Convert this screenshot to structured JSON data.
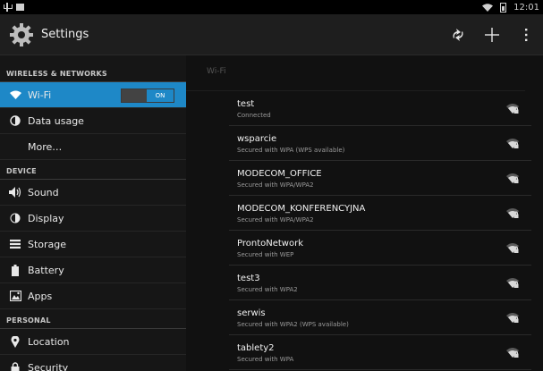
{
  "statusbar": {
    "time": "12:01"
  },
  "app": {
    "title": "Settings"
  },
  "sidebar": {
    "sections": [
      "WIRELESS & NETWORKS",
      "DEVICE",
      "PERSONAL"
    ],
    "wireless": [
      {
        "label": "Wi-Fi",
        "icon": "wifi-icon",
        "selected": true,
        "toggle": "ON"
      },
      {
        "label": "Data usage",
        "icon": "data-usage-icon"
      },
      {
        "label": "More…",
        "icon": ""
      }
    ],
    "device": [
      {
        "label": "Sound",
        "icon": "sound-icon"
      },
      {
        "label": "Display",
        "icon": "display-icon"
      },
      {
        "label": "Storage",
        "icon": "storage-icon"
      },
      {
        "label": "Battery",
        "icon": "battery-icon"
      },
      {
        "label": "Apps",
        "icon": "apps-icon"
      }
    ],
    "personal": [
      {
        "label": "Location",
        "icon": "location-icon"
      },
      {
        "label": "Security",
        "icon": "security-icon"
      }
    ]
  },
  "wifi": {
    "header": "Wi-Fi",
    "networks": [
      {
        "ssid": "test",
        "status": "Connected"
      },
      {
        "ssid": "wsparcie",
        "status": "Secured with WPA (WPS available)"
      },
      {
        "ssid": "MODECOM_OFFICE",
        "status": "Secured with WPA/WPA2"
      },
      {
        "ssid": "MODECOM_KONFERENCYJNA",
        "status": "Secured with WPA/WPA2"
      },
      {
        "ssid": "ProntoNetwork",
        "status": "Secured with WEP"
      },
      {
        "ssid": "test3",
        "status": "Secured with WPA2"
      },
      {
        "ssid": "serwis",
        "status": "Secured with WPA2 (WPS available)"
      },
      {
        "ssid": "tablety2",
        "status": "Secured with WPA"
      }
    ]
  },
  "colors": {
    "accent": "#1e88c7",
    "background": "#111111",
    "sidebar": "#161616"
  }
}
